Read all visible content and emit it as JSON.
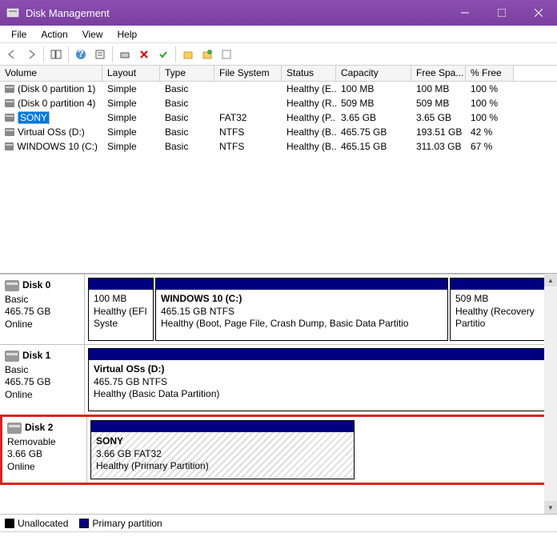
{
  "window": {
    "title": "Disk Management"
  },
  "menu": {
    "file": "File",
    "action": "Action",
    "view": "View",
    "help": "Help"
  },
  "columns": {
    "volume": "Volume",
    "layout": "Layout",
    "type": "Type",
    "fs": "File System",
    "status": "Status",
    "capacity": "Capacity",
    "free": "Free Spa...",
    "pct": "% Free"
  },
  "volumes": [
    {
      "name": "(Disk 0 partition 1)",
      "layout": "Simple",
      "type": "Basic",
      "fs": "",
      "status": "Healthy (E...",
      "capacity": "100 MB",
      "free": "100 MB",
      "pct": "100 %"
    },
    {
      "name": "(Disk 0 partition 4)",
      "layout": "Simple",
      "type": "Basic",
      "fs": "",
      "status": "Healthy (R...",
      "capacity": "509 MB",
      "free": "509 MB",
      "pct": "100 %"
    },
    {
      "name": "SONY",
      "layout": "Simple",
      "type": "Basic",
      "fs": "FAT32",
      "status": "Healthy (P...",
      "capacity": "3.65 GB",
      "free": "3.65 GB",
      "pct": "100 %",
      "selected": true
    },
    {
      "name": "Virtual OSs (D:)",
      "layout": "Simple",
      "type": "Basic",
      "fs": "NTFS",
      "status": "Healthy (B...",
      "capacity": "465.75 GB",
      "free": "193.51 GB",
      "pct": "42 %"
    },
    {
      "name": "WINDOWS 10 (C:)",
      "layout": "Simple",
      "type": "Basic",
      "fs": "NTFS",
      "status": "Healthy (B...",
      "capacity": "465.15 GB",
      "free": "311.03 GB",
      "pct": "67 %"
    }
  ],
  "disks": {
    "d0": {
      "label": "Disk 0",
      "type": "Basic",
      "size": "465.75 GB",
      "status": "Online",
      "p0": {
        "size": "100 MB",
        "status": "Healthy (EFI Syste"
      },
      "p1": {
        "name": "WINDOWS 10  (C:)",
        "size": "465.15 GB NTFS",
        "status": "Healthy (Boot, Page File, Crash Dump, Basic Data Partitio"
      },
      "p2": {
        "size": "509 MB",
        "status": "Healthy (Recovery Partitio"
      }
    },
    "d1": {
      "label": "Disk 1",
      "type": "Basic",
      "size": "465.75 GB",
      "status": "Online",
      "p0": {
        "name": "Virtual OSs  (D:)",
        "size": "465.75 GB NTFS",
        "status": "Healthy (Basic Data Partition)"
      }
    },
    "d2": {
      "label": "Disk 2",
      "type": "Removable",
      "size": "3.66 GB",
      "status": "Online",
      "p0": {
        "name": "SONY",
        "size": "3.66 GB FAT32",
        "status": "Healthy (Primary Partition)"
      }
    }
  },
  "legend": {
    "unalloc": "Unallocated",
    "primary": "Primary partition"
  }
}
